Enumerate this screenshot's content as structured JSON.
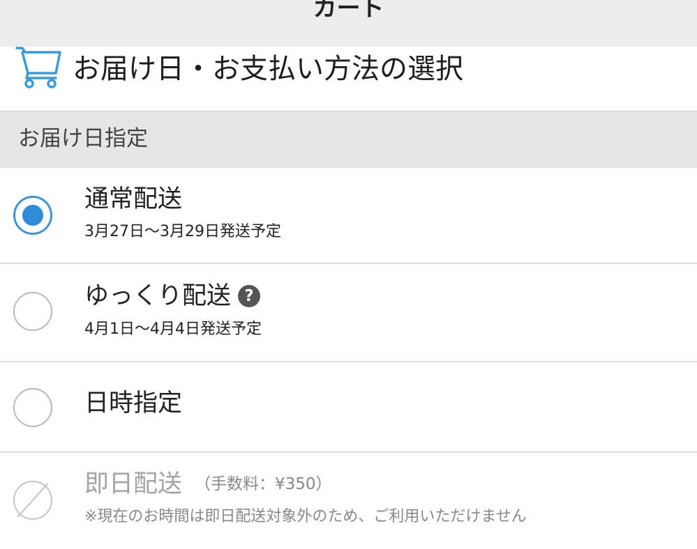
{
  "header": {
    "title": "カート"
  },
  "title_bar": {
    "icon": "cart-icon",
    "title": "お届け日・お支払い方法の選択"
  },
  "delivery_section": {
    "title": "お届け日指定",
    "options": [
      {
        "label": "通常配送",
        "sub": "3月27日〜3月29日発送予定",
        "selected": true
      },
      {
        "label": "ゆっくり配送",
        "help_glyph": "?",
        "sub": "4月1日〜4月4日発送予定",
        "selected": false
      },
      {
        "label": "日時指定",
        "selected": false
      },
      {
        "label": "即日配送",
        "fee": "（手数料：¥350）",
        "sub": "※現在のお時間は即日配送対象外のため、ご利用いただけません",
        "disabled": true
      }
    ]
  },
  "colors": {
    "accent": "#2f8bd8",
    "cart_icon": "#3a9bd5",
    "header_bg": "#ededed",
    "section_bg": "#e6e6e6"
  }
}
